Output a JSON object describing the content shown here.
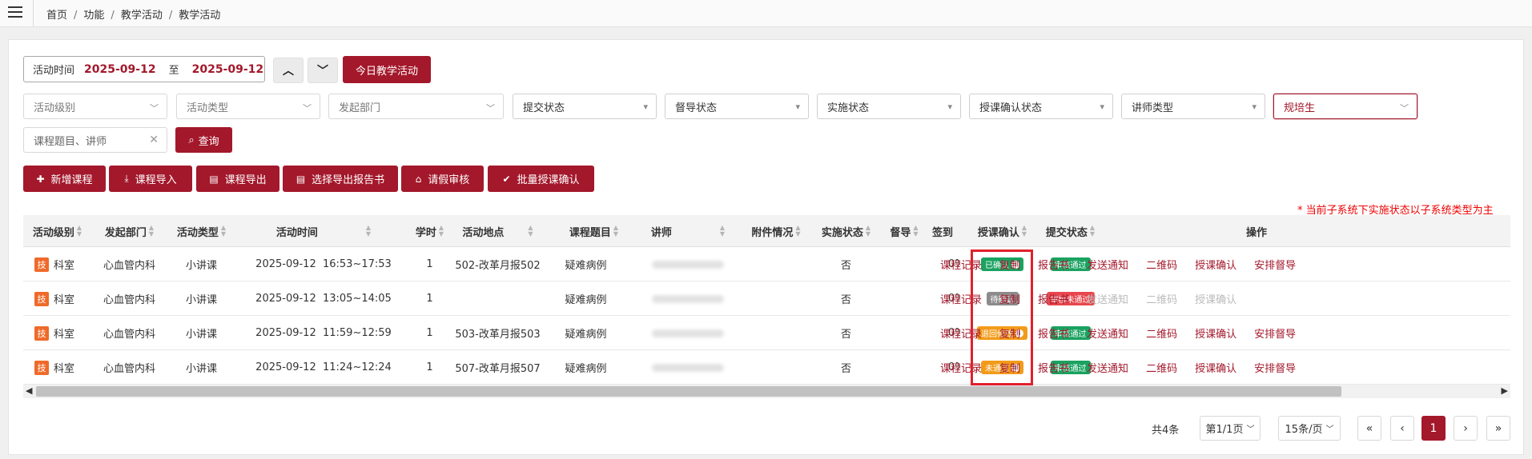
{
  "breadcrumb": [
    "首页",
    "功能",
    "教学活动",
    "教学活动"
  ],
  "date_filter": {
    "label": "活动时间",
    "start": "2025-09-12",
    "to": "至",
    "end": "2025-09-12"
  },
  "today_button": "今日教学活动",
  "filters": [
    {
      "placeholder": "活动级别"
    },
    {
      "placeholder": "活动类型"
    },
    {
      "placeholder": "发起部门"
    },
    {
      "placeholder": "提交状态"
    },
    {
      "placeholder": "督导状态"
    },
    {
      "placeholder": "实施状态"
    },
    {
      "placeholder": "授课确认状态"
    },
    {
      "placeholder": "讲师类型"
    },
    {
      "placeholder": "规培生"
    }
  ],
  "search": {
    "placeholder": "课程题目、讲师",
    "query_label": "查询"
  },
  "actions": [
    "新增课程",
    "课程导入",
    "课程导出",
    "选择导出报告书",
    "请假审核",
    "批量授课确认"
  ],
  "note": "* 当前子系统下实施状态以子系统类型为主",
  "table": {
    "headers": [
      "活动级别",
      "发起部门",
      "活动类型",
      "活动时间",
      "学时",
      "活动地点",
      "课程题目",
      "讲师",
      "附件情况",
      "实施状态",
      "督导",
      "签到",
      "授课确认",
      "提交状态",
      "操作"
    ],
    "rows": [
      {
        "level_badge": "技",
        "level": "科室",
        "dept": "心血管内科",
        "type": "小讲课",
        "time": "2025-09-12  16:53~17:53",
        "hours": "1",
        "place": "502-改革月报502",
        "title": "疑难病例",
        "impl": "否",
        "sign": "0%",
        "confirm": "已确认",
        "confirm_color": "#1aa260",
        "submit": "审核通过",
        "submit_color": "#1aa260",
        "ops": [
          "课程记录",
          "复制",
          "报告书",
          "发送通知",
          "二维码",
          "授课确认",
          "安排督导"
        ],
        "ops_disabled": []
      },
      {
        "level_badge": "技",
        "level": "科室",
        "dept": "心血管内科",
        "type": "小讲课",
        "time": "2025-09-12  13:05~14:05",
        "hours": "1",
        "place": "",
        "title": "疑难病例",
        "impl": "否",
        "sign": "0%",
        "confirm": "待确认",
        "confirm_color": "#8c8c8c",
        "submit": "审核未通过",
        "submit_color": "#e8474f",
        "ops": [
          "课程记录",
          "复制",
          "报告书",
          "发送通知",
          "二维码",
          "授课确认"
        ],
        "ops_disabled": [
          3,
          4,
          5
        ]
      },
      {
        "level_badge": "技",
        "level": "科室",
        "dept": "心血管内科",
        "type": "小讲课",
        "time": "2025-09-12  11:59~12:59",
        "hours": "1",
        "place": "503-改革月报503",
        "title": "疑难病例",
        "impl": "否",
        "sign": "0%",
        "confirm": "退回修改",
        "confirm_color": "#f29b1a",
        "submit": "审核通过",
        "submit_color": "#1aa260",
        "ops": [
          "课程记录",
          "复制",
          "报告书",
          "发送通知",
          "二维码",
          "授课确认",
          "安排督导"
        ],
        "ops_disabled": []
      },
      {
        "level_badge": "技",
        "level": "科室",
        "dept": "心血管内科",
        "type": "小讲课",
        "time": "2025-09-12  11:24~12:24",
        "hours": "1",
        "place": "507-改革月报507",
        "title": "疑难病例",
        "impl": "否",
        "sign": "0%",
        "confirm": "未通过",
        "confirm_color": "#f29b1a",
        "submit": "审核通过",
        "submit_color": "#1aa260",
        "ops": [
          "课程记录",
          "复制",
          "报告书",
          "发送通知",
          "二维码",
          "授课确认",
          "安排督导"
        ],
        "ops_disabled": []
      }
    ]
  },
  "pagination": {
    "total": "共4条",
    "page_select": "第1/1页",
    "size_select": "15条/页",
    "first": "«",
    "prev": "‹",
    "current": "1",
    "next": "›",
    "last": "»"
  },
  "colors": {
    "primary": "#a3182b",
    "highlight_box": "#e0202c",
    "note": "#ee0000"
  }
}
